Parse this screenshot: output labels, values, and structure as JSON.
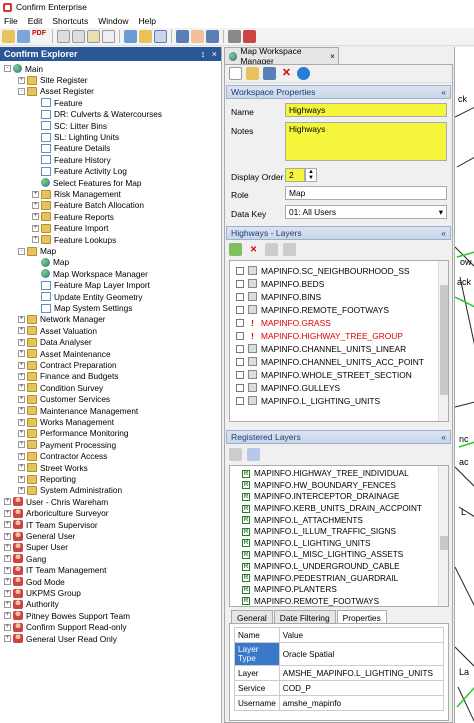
{
  "window": {
    "title": "Confirm Enterprise"
  },
  "menu": [
    "File",
    "Edit",
    "Shortcuts",
    "Window",
    "Help"
  ],
  "toolbar": {
    "pdf_label": "PDF"
  },
  "explorer": {
    "title": "Confirm Explorer",
    "pin_glyph": "↕",
    "close_glyph": "×",
    "tree": [
      {
        "label": "Main",
        "level": 0,
        "icon": "globe",
        "exp": "-"
      },
      {
        "label": "Site Register",
        "level": 1,
        "icon": "folder",
        "exp": "+"
      },
      {
        "label": "Asset Register",
        "level": 1,
        "icon": "folder",
        "exp": "-"
      },
      {
        "label": "Feature",
        "level": 2,
        "icon": "doc",
        "exp": ""
      },
      {
        "label": "DR: Culverts & Watercourses",
        "level": 2,
        "icon": "doc",
        "exp": ""
      },
      {
        "label": "SC: Litter Bins",
        "level": 2,
        "icon": "doc",
        "exp": ""
      },
      {
        "label": "SL: Lighting Units",
        "level": 2,
        "icon": "doc",
        "exp": ""
      },
      {
        "label": "Feature Details",
        "level": 2,
        "icon": "doc",
        "exp": ""
      },
      {
        "label": "Feature History",
        "level": 2,
        "icon": "doc",
        "exp": ""
      },
      {
        "label": "Feature Activity Log",
        "level": 2,
        "icon": "doc",
        "exp": ""
      },
      {
        "label": "Select Features for Map",
        "level": 2,
        "icon": "globe",
        "exp": ""
      },
      {
        "label": "Risk Management",
        "level": 2,
        "icon": "folder",
        "exp": "+"
      },
      {
        "label": "Feature Batch Allocation",
        "level": 2,
        "icon": "folder",
        "exp": "+"
      },
      {
        "label": "Feature Reports",
        "level": 2,
        "icon": "folder",
        "exp": "+"
      },
      {
        "label": "Feature Import",
        "level": 2,
        "icon": "folder",
        "exp": "+"
      },
      {
        "label": "Feature Lookups",
        "level": 2,
        "icon": "folder",
        "exp": "+"
      },
      {
        "label": "Map",
        "level": 1,
        "icon": "folder",
        "exp": "-"
      },
      {
        "label": "Map",
        "level": 2,
        "icon": "globe",
        "exp": ""
      },
      {
        "label": "Map Workspace Manager",
        "level": 2,
        "icon": "globe",
        "exp": ""
      },
      {
        "label": "Feature Map Layer Import",
        "level": 2,
        "icon": "doc",
        "exp": ""
      },
      {
        "label": "Update Entity Geometry",
        "level": 2,
        "icon": "doc",
        "exp": ""
      },
      {
        "label": "Map System Settings",
        "level": 2,
        "icon": "doc",
        "exp": ""
      },
      {
        "label": "Network Manager",
        "level": 1,
        "icon": "folder",
        "exp": "+"
      },
      {
        "label": "Asset Valuation",
        "level": 1,
        "icon": "folder",
        "exp": "+"
      },
      {
        "label": "Data Analyser",
        "level": 1,
        "icon": "folder",
        "exp": "+"
      },
      {
        "label": "Asset Maintenance",
        "level": 1,
        "icon": "folder",
        "exp": "+"
      },
      {
        "label": "Contract Preparation",
        "level": 1,
        "icon": "folder",
        "exp": "+"
      },
      {
        "label": "Finance and Budgets",
        "level": 1,
        "icon": "folder",
        "exp": "+"
      },
      {
        "label": "Condition Survey",
        "level": 1,
        "icon": "folder",
        "exp": "+"
      },
      {
        "label": "Customer Services",
        "level": 1,
        "icon": "folder",
        "exp": "+"
      },
      {
        "label": "Maintenance Management",
        "level": 1,
        "icon": "folder",
        "exp": "+"
      },
      {
        "label": "Works Management",
        "level": 1,
        "icon": "folder",
        "exp": "+"
      },
      {
        "label": "Performance Monitoring",
        "level": 1,
        "icon": "folder",
        "exp": "+"
      },
      {
        "label": "Payment Processing",
        "level": 1,
        "icon": "folder",
        "exp": "+"
      },
      {
        "label": "Contractor Access",
        "level": 1,
        "icon": "folder",
        "exp": "+"
      },
      {
        "label": "Street Works",
        "level": 1,
        "icon": "folder",
        "exp": "+"
      },
      {
        "label": "Reporting",
        "level": 1,
        "icon": "folder",
        "exp": "+"
      },
      {
        "label": "System Administration",
        "level": 1,
        "icon": "folder",
        "exp": "+"
      },
      {
        "label": "User - Chris Wareham",
        "level": 0,
        "icon": "user",
        "exp": "+"
      },
      {
        "label": "Arboriculture Surveyor",
        "level": 0,
        "icon": "user",
        "exp": "+"
      },
      {
        "label": "IT Team Supervisor",
        "level": 0,
        "icon": "user",
        "exp": "+"
      },
      {
        "label": "General User",
        "level": 0,
        "icon": "user",
        "exp": "+"
      },
      {
        "label": "Super User",
        "level": 0,
        "icon": "user",
        "exp": "+"
      },
      {
        "label": "Gang",
        "level": 0,
        "icon": "user",
        "exp": "+"
      },
      {
        "label": "IT Team Management",
        "level": 0,
        "icon": "user",
        "exp": "+"
      },
      {
        "label": "God Mode",
        "level": 0,
        "icon": "user",
        "exp": "+"
      },
      {
        "label": "UKPMS Group",
        "level": 0,
        "icon": "user",
        "exp": "+"
      },
      {
        "label": "Authority",
        "level": 0,
        "icon": "user",
        "exp": "+"
      },
      {
        "label": "Pitney Bowes Support Team",
        "level": 0,
        "icon": "user",
        "exp": "+"
      },
      {
        "label": "Confirm Support Read-only",
        "level": 0,
        "icon": "user",
        "exp": "+"
      },
      {
        "label": "General User Read Only",
        "level": 0,
        "icon": "user",
        "exp": "+"
      }
    ]
  },
  "tab": {
    "label": "Map Workspace Manager",
    "close_glyph": "×"
  },
  "workspace_properties": {
    "title": "Workspace Properties",
    "collapse_glyph": "«",
    "name_label": "Name",
    "name_value": "Highways",
    "notes_label": "Notes",
    "notes_value": "Highways",
    "display_order_label": "Display Order",
    "display_order_value": "2",
    "role_label": "Role",
    "role_value": "Map",
    "data_key_label": "Data Key",
    "data_key_value": "01: All Users"
  },
  "highways_layers": {
    "title": "Highways - Layers",
    "layers": [
      {
        "name": "MAPINFO.SC_NEIGHBOURHOOD_SS",
        "warn": false
      },
      {
        "name": "MAPINFO.BEDS",
        "warn": false
      },
      {
        "name": "MAPINFO.BINS",
        "warn": false
      },
      {
        "name": "MAPINFO.REMOTE_FOOTWAYS",
        "warn": false
      },
      {
        "name": "MAPINFO.GRASS",
        "warn": true
      },
      {
        "name": "MAPINFO.HIGHWAY_TREE_GROUP",
        "warn": true
      },
      {
        "name": "MAPINFO.CHANNEL_UNITS_LINEAR",
        "warn": false
      },
      {
        "name": "MAPINFO.CHANNEL_UNITS_ACC_POINT",
        "warn": false
      },
      {
        "name": "MAPINFO.WHOLE_STREET_SECTION",
        "warn": false
      },
      {
        "name": "MAPINFO.GULLEYS",
        "warn": false
      },
      {
        "name": "MAPINFO.L_LIGHTING_UNITS",
        "warn": false
      }
    ],
    "warn_glyph": "!"
  },
  "registered_layers": {
    "title": "Registered Layers",
    "badge": "R",
    "layers": [
      "MAPINFO.HIGHWAY_TREE_INDIVIDUAL",
      "MAPINFO.HW_BOUNDARY_FENCES",
      "MAPINFO.INTERCEPTOR_DRAINAGE",
      "MAPINFO.KERB_UNITS_DRAIN_ACCPOINT",
      "MAPINFO.L_ATTACHMENTS",
      "MAPINFO.L_ILLUM_TRAFFIC_SIGNS",
      "MAPINFO.L_LIGHTING_UNITS",
      "MAPINFO.L_MISC_LIGHTING_ASSETS",
      "MAPINFO.L_UNDERGROUND_CABLE",
      "MAPINFO.PEDESTRIAN_GUARDRAIL",
      "MAPINFO.PLANTERS",
      "MAPINFO.REMOTE_FOOTWAYS"
    ],
    "tabs": [
      "General",
      "Date Filtering",
      "Properties"
    ],
    "prop_headers": [
      "Name",
      "Value"
    ],
    "props": [
      {
        "k": "Layer Type",
        "v": "Oracle Spatial"
      },
      {
        "k": "Layer",
        "v": "AMSHE_MAPINFO.L_LIGHTING_UNITS"
      },
      {
        "k": "Service",
        "v": "COD_P"
      },
      {
        "k": "Username",
        "v": "amshe_mapinfo"
      }
    ]
  },
  "map_fragments": [
    "ck",
    "ow",
    "ack",
    "nc",
    "ac",
    "L",
    "La"
  ]
}
